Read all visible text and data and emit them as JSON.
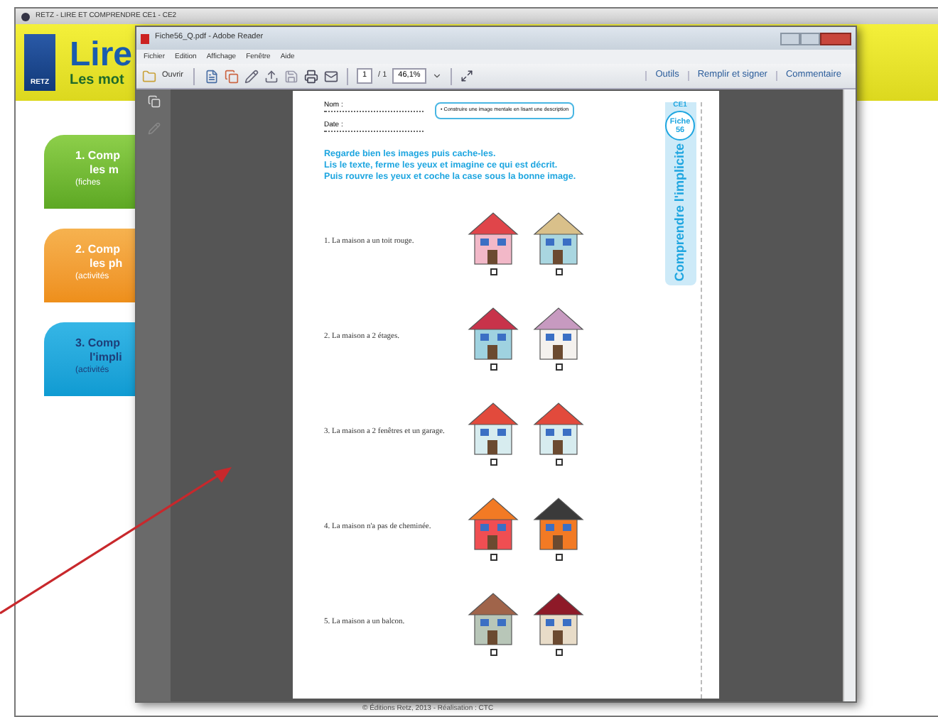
{
  "back_window": {
    "title": "RETZ - LIRE ET COMPRENDRE CE1 - CE2",
    "header_title": "Lire",
    "header_subtitle": "Les mot",
    "logo": "RETZ",
    "menu_cards": [
      {
        "kind": "green",
        "line1": "1. Comp",
        "line2": "les m",
        "line3": "(fiches"
      },
      {
        "kind": "orange",
        "line1": "2. Comp",
        "line2": "les ph",
        "line3": "(activités"
      },
      {
        "kind": "blue",
        "line1": "3. Comp",
        "line2": "l'impli",
        "line3": "(activités"
      }
    ],
    "footer": "© Éditions Retz, 2013 - Réalisation : CTC"
  },
  "reader": {
    "title": "Fiche56_Q.pdf - Adobe Reader",
    "menu": [
      "Fichier",
      "Edition",
      "Affichage",
      "Fenêtre",
      "Aide"
    ],
    "open_button": "Ouvrir",
    "page_number": "1",
    "page_total": "/ 1",
    "zoom": "46,1%",
    "panels": [
      "Outils",
      "Remplir et signer",
      "Commentaire"
    ],
    "document": {
      "name_label": "Nom :",
      "date_label": "Date :",
      "objective": "• Construire une image mentale en lisant une description",
      "level": "CE1",
      "sheet": "Fiche 56",
      "strip_title": "Comprendre l'implicite",
      "instructions": [
        "Regarde bien les images puis cache-les.",
        "Lis le texte, ferme les yeux et imagine ce qui est décrit.",
        "Puis rouvre les yeux et coche la case sous la bonne image."
      ],
      "items": [
        {
          "text": "1. La maison a un toit rouge.",
          "options": [
            {
              "checked": false
            },
            {
              "checked": false
            }
          ]
        },
        {
          "text": "2. La maison a 2 étages.",
          "options": [
            {
              "checked": false
            },
            {
              "checked": false
            }
          ]
        },
        {
          "text": "3. La maison a 2 fenêtres et un garage.",
          "options": [
            {
              "checked": false
            },
            {
              "checked": false
            }
          ]
        },
        {
          "text": "4. La maison n'a pas de cheminée.",
          "options": [
            {
              "checked": false
            },
            {
              "checked": false
            }
          ]
        },
        {
          "text": "5. La maison a un balcon.",
          "options": [
            {
              "checked": false
            },
            {
              "checked": false
            }
          ]
        }
      ]
    }
  }
}
